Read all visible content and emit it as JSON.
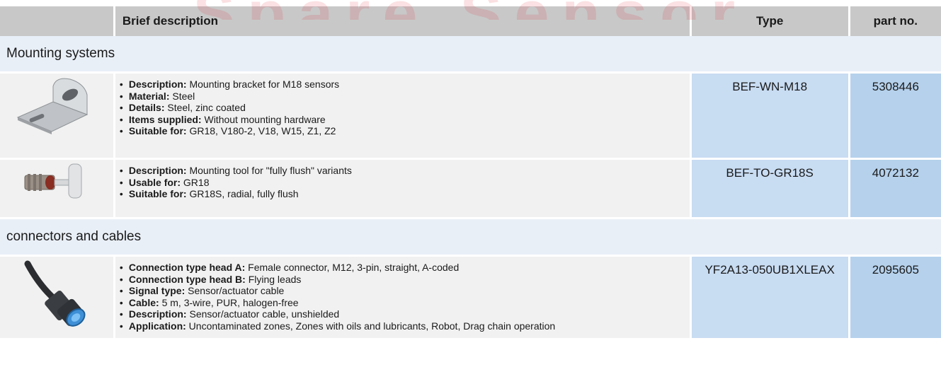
{
  "watermark": "Spare Sensor",
  "header": {
    "description": "Brief description",
    "type": "Type",
    "part": "part no."
  },
  "sections": [
    {
      "title": "Mounting systems",
      "items": [
        {
          "image": "mounting-bracket-icon",
          "lines": [
            {
              "label": "Description:",
              "text": " Mounting bracket for M18 sensors"
            },
            {
              "label": "Material:",
              "text": " Steel"
            },
            {
              "label": "Details:",
              "text": " Steel, zinc coated"
            },
            {
              "label": "Items supplied:",
              "text": " Without mounting hardware"
            },
            {
              "label": "Suitable for:",
              "text": " GR18, V180-2, V18, W15, Z1, Z2"
            }
          ],
          "type": "BEF-WN-M18",
          "part": "5308446"
        },
        {
          "image": "mounting-tool-icon",
          "lines": [
            {
              "label": "Description:",
              "text": " Mounting tool for \"fully flush\" variants"
            },
            {
              "label": "Usable for:",
              "text": " GR18"
            },
            {
              "label": "Suitable for:",
              "text": " GR18S, radial, fully flush"
            }
          ],
          "type": "BEF-TO-GR18S",
          "part": "4072132"
        }
      ]
    },
    {
      "title": "connectors and cables",
      "items": [
        {
          "image": "cable-connector-icon",
          "lines": [
            {
              "label": "Connection type head A:",
              "text": " Female connector, M12, 3-pin, straight, A-coded"
            },
            {
              "label": "Connection type head B:",
              "text": " Flying leads"
            },
            {
              "label": "Signal type:",
              "text": " Sensor/actuator cable"
            },
            {
              "label": "Cable:",
              "text": " 5 m, 3-wire, PUR, halogen-free"
            },
            {
              "label": "Description:",
              "text": " Sensor/actuator cable, unshielded"
            },
            {
              "label": "Application:",
              "text": " Uncontaminated zones, Zones with oils and lubricants, Robot, Drag chain operation"
            }
          ],
          "type": "YF2A13-050UB1XLEAX",
          "part": "2095605"
        }
      ]
    }
  ]
}
